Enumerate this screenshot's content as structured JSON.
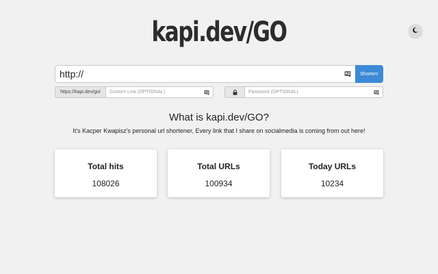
{
  "header": {
    "logo": "kapi.dev/GO",
    "theme_toggle_icon": "moon-icon"
  },
  "shorten_form": {
    "url_placeholder": "http://",
    "shorten_label": "Shorten!",
    "domain_prefix": "https://kapi.dev/go/",
    "custom_link_placeholder": "Custom Link (OPTIONAL)",
    "password_icon": "lock-icon",
    "password_placeholder": "Password (OPTIONAL)",
    "autofill_icon": "contact-card-icon"
  },
  "about": {
    "title": "What is kapi.dev/GO?",
    "description": "It's Kacper Kwapisz's personal url shortener, Every link that I share on socialmedia is coming from out here!"
  },
  "stats": [
    {
      "label": "Total hits",
      "value": "108026"
    },
    {
      "label": "Total URLs",
      "value": "100934"
    },
    {
      "label": "Today URLs",
      "value": "10234"
    }
  ],
  "colors": {
    "background": "#f1f1f1",
    "accent": "#3c8ad6",
    "card": "#ffffff"
  }
}
